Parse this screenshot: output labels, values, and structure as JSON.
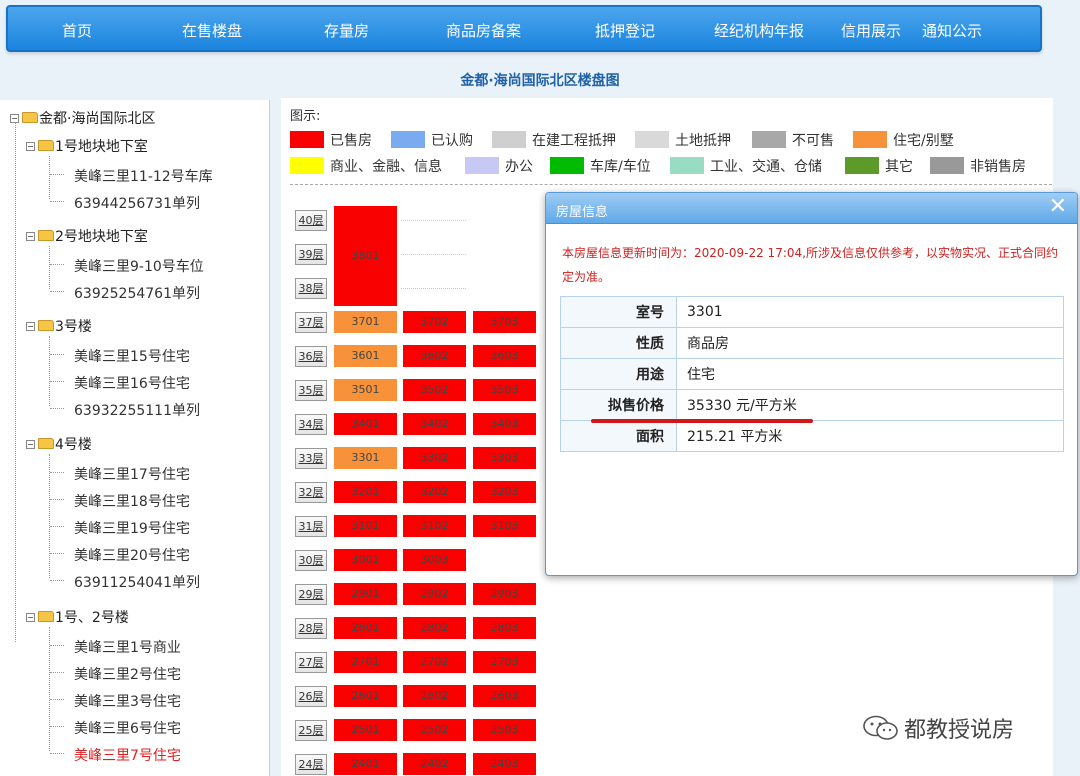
{
  "nav": [
    "首页",
    "在售楼盘",
    "存量房",
    "商品房备案",
    "抵押登记",
    "经纪机构年报",
    "信用展示",
    "通知公示"
  ],
  "page_title": "金都·海尚国际北区楼盘图",
  "tree": {
    "root": "金都·海尚国际北区",
    "groups": [
      {
        "label": "1号地块地下室",
        "items": [
          "美峰三里11-12号车库",
          "63944256731单列"
        ]
      },
      {
        "label": "2号地块地下室",
        "items": [
          "美峰三里9-10号车位",
          "63925254761单列"
        ]
      },
      {
        "label": "3号楼",
        "items": [
          "美峰三里15号住宅",
          "美峰三里16号住宅",
          "63932255111单列"
        ]
      },
      {
        "label": "4号楼",
        "items": [
          "美峰三里17号住宅",
          "美峰三里18号住宅",
          "美峰三里19号住宅",
          "美峰三里20号住宅",
          "63911254041单列"
        ]
      },
      {
        "label": "1号、2号楼",
        "items": [
          "美峰三里1号商业",
          "美峰三里2号住宅",
          "美峰三里3号住宅",
          "美峰三里6号住宅",
          "美峰三里7号住宅"
        ]
      }
    ]
  },
  "legend": {
    "title": "图示:",
    "items": [
      {
        "label": "已售房",
        "color": "#fa0101"
      },
      {
        "label": "已认购",
        "color": "#7aaaf0"
      },
      {
        "label": "在建工程抵押",
        "color": "#cfcfcf"
      },
      {
        "label": "土地抵押",
        "color": "#d9d9d9"
      },
      {
        "label": "不可售",
        "color": "#a8a8a8"
      },
      {
        "label": "住宅/别墅",
        "color": "#f7923a"
      },
      {
        "label": "商业、金融、信息",
        "color": "#ffff00"
      },
      {
        "label": "办公",
        "color": "#c8c8f5"
      },
      {
        "label": "车库/车位",
        "color": "#00bb00"
      },
      {
        "label": "工业、交通、仓储",
        "color": "#99dcc4"
      },
      {
        "label": "其它",
        "color": "#5e9a2a"
      },
      {
        "label": "非销售房",
        "color": "#999999"
      }
    ]
  },
  "floors": [
    "40层",
    "39层",
    "38层",
    "37层",
    "36层",
    "35层",
    "34层",
    "33层",
    "32层",
    "31层",
    "30层",
    "29层",
    "28层",
    "27层",
    "26层",
    "25层",
    "24层"
  ],
  "units": {
    "big_unit": "3801",
    "rows": [
      [
        "3701",
        "3702",
        "3703"
      ],
      [
        "3601",
        "3602",
        "3603"
      ],
      [
        "3501",
        "3502",
        "3503"
      ],
      [
        "3401",
        "3402",
        "3403"
      ],
      [
        "3301",
        "3302",
        "3303"
      ],
      [
        "3201",
        "3202",
        "3203"
      ],
      [
        "3101",
        "3102",
        "3103"
      ],
      [
        "3001",
        "3003"
      ],
      [
        "2901",
        "2902",
        "2903"
      ],
      [
        "2801",
        "2802",
        "2803"
      ],
      [
        "2701",
        "2702",
        "2703"
      ],
      [
        "2601",
        "2602",
        "2603"
      ],
      [
        "2501",
        "2502",
        "2503"
      ],
      [
        "2401",
        "2402",
        "2403"
      ]
    ],
    "orange_units": [
      "3701",
      "3601",
      "3501",
      "3301"
    ]
  },
  "popup": {
    "title": "房屋信息",
    "close": "✕",
    "note": "本房屋信息更新时间为：2020-09-22 17:04,所涉及信息仅供参考，以实物实况、正式合同约定为准。",
    "rows": [
      {
        "key": "室号",
        "value": "3301"
      },
      {
        "key": "性质",
        "value": "商品房"
      },
      {
        "key": "用途",
        "value": "住宅"
      },
      {
        "key": "拟售价格",
        "value": "35330 元/平方米"
      },
      {
        "key": "面积",
        "value": "215.21 平方米"
      }
    ]
  },
  "watermark": "都教授说房"
}
